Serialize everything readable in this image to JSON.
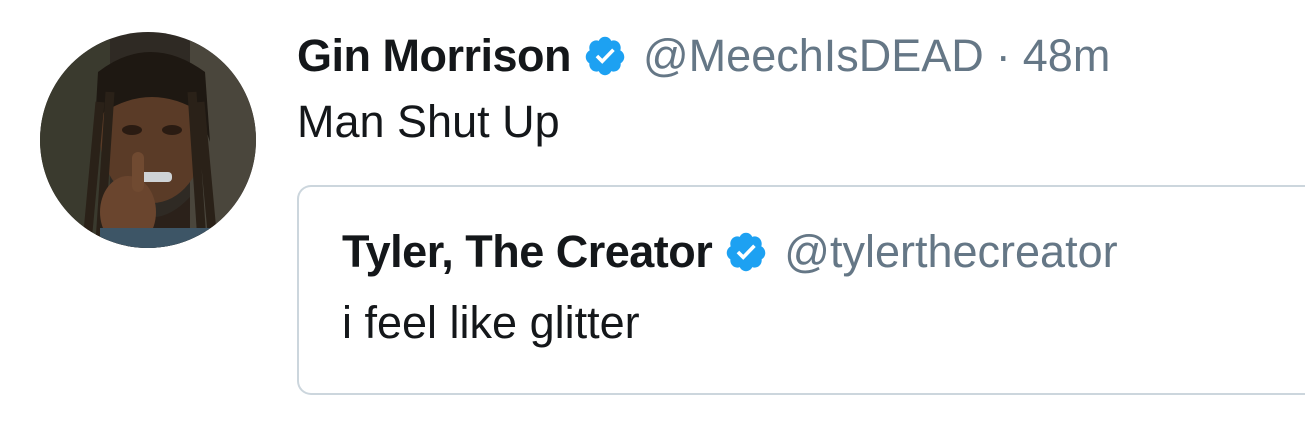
{
  "tweet": {
    "display_name": "Gin Morrison",
    "handle": "@MeechIsDEAD",
    "separator": "·",
    "timestamp": "48m",
    "text": "Man Shut Up",
    "verified_icon": "verified-badge-icon",
    "avatar_icon": "user-avatar-photo"
  },
  "quoted_tweet": {
    "display_name": "Tyler, The Creator",
    "handle": "@tylerthecreator",
    "text": "i feel like glitter",
    "verified_icon": "verified-badge-icon"
  },
  "colors": {
    "text_primary": "#14171a",
    "text_secondary": "#657786",
    "verified_blue": "#1da1f2",
    "quote_border": "#ccd6dd"
  }
}
